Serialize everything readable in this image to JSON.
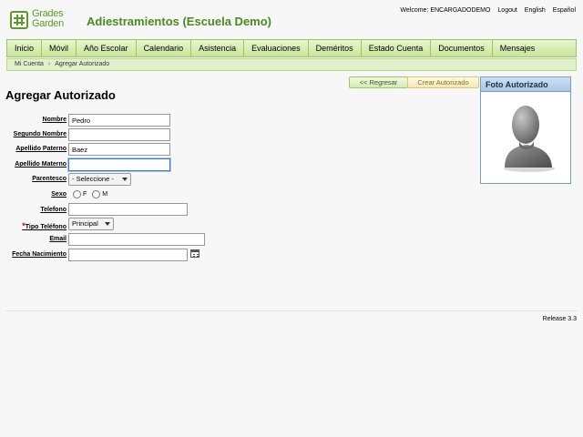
{
  "header": {
    "logo_text_1": "Grades",
    "logo_text_2": "Garden",
    "app_title": "Adiestramientos (Escuela Demo)",
    "welcome": "Welcome: ENCARGADODEMO",
    "logout": "Logout",
    "lang_en": "English",
    "lang_es": "Español"
  },
  "menu": [
    {
      "label": "Inicio"
    },
    {
      "label": "Móvil"
    },
    {
      "label": "Año Escolar"
    },
    {
      "label": "Calendario"
    },
    {
      "label": "Asistencia"
    },
    {
      "label": "Evaluaciones"
    },
    {
      "label": "Deméritos"
    },
    {
      "label": "Estado Cuenta"
    },
    {
      "label": "Documentos"
    },
    {
      "label": "Mensajes"
    }
  ],
  "breadcrumb": {
    "item1": "Mi Cuenta",
    "separator": "›",
    "item2": "Agregar Autorizado"
  },
  "actions": {
    "back": "<< Regresar",
    "create": "Crear Autorizado"
  },
  "page_title": "Agregar Autorizado",
  "form": {
    "nombre": {
      "label": "Nombre",
      "value": "Pedro"
    },
    "segundo_nombre": {
      "label": "Segundo Nombre",
      "value": ""
    },
    "apellido_paterno": {
      "label": "Apellido Paterno",
      "value": "Baez"
    },
    "apellido_materno": {
      "label": "Apellido Materno",
      "value": ""
    },
    "parentesco": {
      "label": "Parentesco",
      "value": "- Seleccione -"
    },
    "sexo": {
      "label": "Sexo",
      "opt_f": "F",
      "opt_m": "M"
    },
    "telefono": {
      "label": "Telefono",
      "value": ""
    },
    "tipo_telefono": {
      "label": "Tipo Teléfono",
      "required": "*",
      "value": "Principal"
    },
    "email": {
      "label": "Email",
      "value": ""
    },
    "fecha_nacimiento": {
      "label": "Fecha Nacimiento",
      "value": ""
    }
  },
  "photo": {
    "title": "Foto Autorizado"
  },
  "footer": {
    "release": "Release 3.3"
  },
  "colors": {
    "brand_green": "#5a9a2a",
    "menu_bg": "#c8e59a",
    "photo_header": "#a9c6e6"
  }
}
